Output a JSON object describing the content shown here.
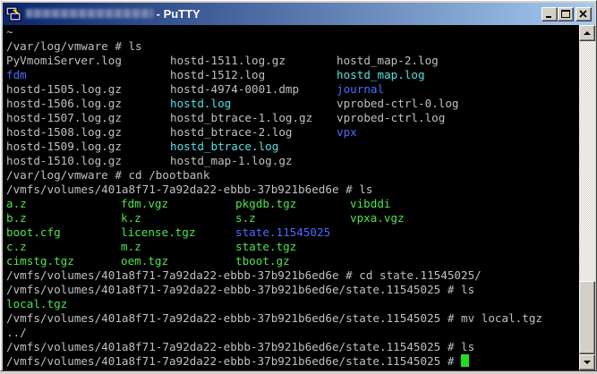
{
  "window": {
    "title": "PuTTY",
    "title_prefix": " - "
  },
  "colors": {
    "terminal_bg": "#000000",
    "text": "#c0c0c0",
    "directory": "#4b6cff",
    "symlink": "#55e0e0",
    "archive": "#4ee44e",
    "cursor": "#22dd22"
  },
  "icons": {
    "app": "putty-icon",
    "minimize": "minimize-icon",
    "maximize": "maximize-icon",
    "close": "close-icon",
    "scroll_up": "arrow-up-icon",
    "scroll_down": "arrow-down-icon"
  },
  "terminal": {
    "l0": "~",
    "l1": "/var/log/vmware # ls",
    "ls1": {
      "r0": [
        "PyVmomiServer.log",
        "hostd-1511.log.gz",
        "hostd_map-2.log"
      ],
      "r1": [
        "fdm",
        "hostd-1512.log",
        "hostd_map.log"
      ],
      "r2": [
        "hostd-1505.log.gz",
        "hostd-4974-0001.dmp",
        "journal"
      ],
      "r3": [
        "hostd-1506.log.gz",
        "hostd.log",
        "vprobed-ctrl-0.log"
      ],
      "r4": [
        "hostd-1507.log.gz",
        "hostd_btrace-1.log.gz",
        "vprobed-ctrl.log"
      ],
      "r5": [
        "hostd-1508.log.gz",
        "hostd_btrace-2.log",
        "vpx"
      ],
      "r6": [
        "hostd-1509.log.gz",
        "hostd_btrace.log",
        ""
      ],
      "r7": [
        "hostd-1510.log.gz",
        "hostd_map-1.log.gz",
        ""
      ]
    },
    "l10": "/var/log/vmware # cd /bootbank",
    "l11": "/vmfs/volumes/401a8f71-7a92da22-ebbb-37b921b6ed6e # ls",
    "ls2": {
      "r0": [
        "a.z",
        "fdm.vgz",
        "pkgdb.tgz",
        "vibddi"
      ],
      "r1": [
        "b.z",
        "k.z",
        "s.z",
        "vpxa.vgz"
      ],
      "r2": [
        "boot.cfg",
        "license.tgz",
        "state.11545025",
        ""
      ],
      "r3": [
        "c.z",
        "m.z",
        "state.tgz",
        ""
      ],
      "r4": [
        "cimstg.tgz",
        "oem.tgz",
        "tboot.gz",
        ""
      ]
    },
    "l17": "/vmfs/volumes/401a8f71-7a92da22-ebbb-37b921b6ed6e # cd state.11545025/",
    "l18": "/vmfs/volumes/401a8f71-7a92da22-ebbb-37b921b6ed6e/state.11545025 # ls",
    "l19": "local.tgz",
    "l20": "/vmfs/volumes/401a8f71-7a92da22-ebbb-37b921b6ed6e/state.11545025 # mv local.tgz",
    "l21": "../",
    "l22": "/vmfs/volumes/401a8f71-7a92da22-ebbb-37b921b6ed6e/state.11545025 # ls",
    "l23": "/vmfs/volumes/401a8f71-7a92da22-ebbb-37b921b6ed6e/state.11545025 # "
  }
}
